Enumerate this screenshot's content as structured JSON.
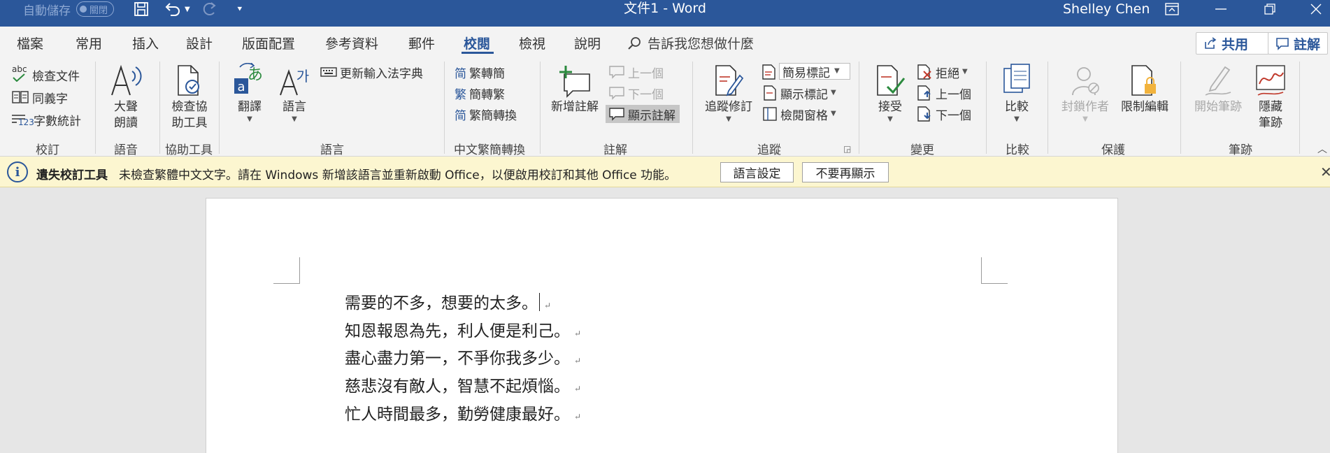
{
  "titlebar": {
    "autosave_label": "自動儲存",
    "autosave_state": "關閉",
    "document_title": "文件1  -  Word",
    "user_name": "Shelley Chen"
  },
  "tabs": [
    {
      "label": "檔案",
      "active": false
    },
    {
      "label": "常用",
      "active": false
    },
    {
      "label": "插入",
      "active": false
    },
    {
      "label": "設計",
      "active": false
    },
    {
      "label": "版面配置",
      "active": false
    },
    {
      "label": "參考資料",
      "active": false
    },
    {
      "label": "郵件",
      "active": false
    },
    {
      "label": "校閱",
      "active": true
    },
    {
      "label": "檢視",
      "active": false
    },
    {
      "label": "說明",
      "active": false
    }
  ],
  "tell_me": "告訴我您想做什麼",
  "share_label": "共用",
  "comments_label": "註解",
  "ribbon": {
    "proofing": {
      "label": "校訂",
      "spelling": "檢查文件",
      "thesaurus": "同義字",
      "word_count": "字數統計",
      "abc": "abc",
      "num": "123"
    },
    "speech": {
      "label": "語音",
      "read_aloud": [
        "大聲",
        "朗讀"
      ]
    },
    "accessibility": {
      "label": "協助工具",
      "check": [
        "檢查協",
        "助工具"
      ]
    },
    "language": {
      "label": "語言",
      "translate": "翻譯",
      "language": "語言",
      "update_ime": "更新輸入法字典"
    },
    "chinese_conversion": {
      "label": "中文繁簡轉換",
      "to_trad": "繁轉簡",
      "to_simp": "簡轉繁",
      "convert": "繁簡轉換",
      "glyph_simp": "简",
      "glyph_trad": "繁",
      "glyph_conv": "简"
    },
    "comments": {
      "label": "註解",
      "new_comment": "新增註解",
      "previous": "上一個",
      "next": "下一個",
      "show_comments": "顯示註解"
    },
    "tracking": {
      "label": "追蹤",
      "track_changes": "追蹤修訂",
      "markup": "簡易標記",
      "show_markup": "顯示標記",
      "reviewing_pane": "檢閱窗格"
    },
    "changes": {
      "label": "變更",
      "accept": "接受",
      "reject": "拒絕",
      "previous": "上一個",
      "next": "下一個"
    },
    "compare": {
      "label": "比較",
      "compare": "比較"
    },
    "protect": {
      "label": "保護",
      "block_authors": "封鎖作者",
      "restrict_editing": "限制編輯"
    },
    "ink": {
      "label": "筆跡",
      "start_inking": "開始筆跡",
      "hide_ink": [
        "隱藏",
        "筆跡"
      ]
    }
  },
  "message_bar": {
    "title": "遺失校訂工具",
    "text": "未檢查繁體中文文字。請在 Windows 新增該語言並重新啟動 Office，以便啟用校訂和其他 Office 功能。",
    "language_settings": "語言設定",
    "dont_show_again": "不要再顯示",
    "close_glyph": "✕",
    "info_glyph": "i"
  },
  "document": {
    "lines": [
      "需要的不多，想要的太多。",
      "知恩報恩為先，利人便是利己。",
      "盡心盡力第一，不爭你我多少。",
      "慈悲沒有敵人，智慧不起煩惱。",
      "忙人時間最多，勤勞健康最好。"
    ],
    "paragraph_mark": "↵"
  },
  "colors": {
    "accent": "#2b579a",
    "message_bar": "#fcf6d0",
    "ribbon": "#f3f3f3"
  }
}
